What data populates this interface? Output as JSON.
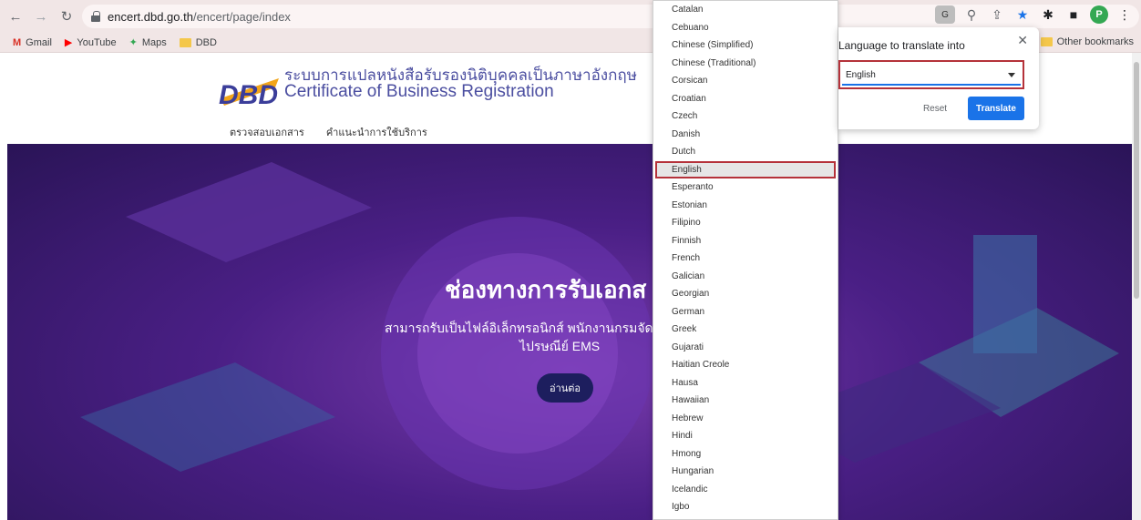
{
  "browser": {
    "url_host": "encert.dbd.go.th",
    "url_path": "/encert/page/index",
    "avatar_letter": "P",
    "bookmarks": [
      {
        "label": "Gmail"
      },
      {
        "label": "YouTube"
      },
      {
        "label": "Maps"
      },
      {
        "label": "DBD"
      }
    ],
    "other_bookmarks": "Other bookmarks"
  },
  "site": {
    "logo_text": "DBD",
    "title_th": "ระบบการแปลหนังสือรับรองนิติบุคคลเป็นภาษาอังกฤษ",
    "title_en": "Certificate of Business Registration",
    "nav": [
      "ตรวจสอบเอกสาร",
      "คำแนะนำการใช้บริการ"
    ]
  },
  "hero": {
    "title": "ช่องทางการรับเอกส",
    "sub1": "สามารถรับเป็นไฟล์อิเล็กทรอนิกส์ พนักงานกรมจัด",
    "sub2": "ไปรษณีย์ EMS",
    "read_more": "อ่านต่อ"
  },
  "language_list": [
    "Catalan",
    "Cebuano",
    "Chinese (Simplified)",
    "Chinese (Traditional)",
    "Corsican",
    "Croatian",
    "Czech",
    "Danish",
    "Dutch",
    "English",
    "Esperanto",
    "Estonian",
    "Filipino",
    "Finnish",
    "French",
    "Galician",
    "Georgian",
    "German",
    "Greek",
    "Gujarati",
    "Haitian Creole",
    "Hausa",
    "Hawaiian",
    "Hebrew",
    "Hindi",
    "Hmong",
    "Hungarian",
    "Icelandic",
    "Igbo"
  ],
  "language_selected": "English",
  "translate_popup": {
    "title": "Language to translate into",
    "selected": "English",
    "reset": "Reset",
    "translate": "Translate"
  },
  "colors": {
    "accent": "#1a73e8",
    "highlight": "#b5323a",
    "brand": "#4b4ea0"
  }
}
